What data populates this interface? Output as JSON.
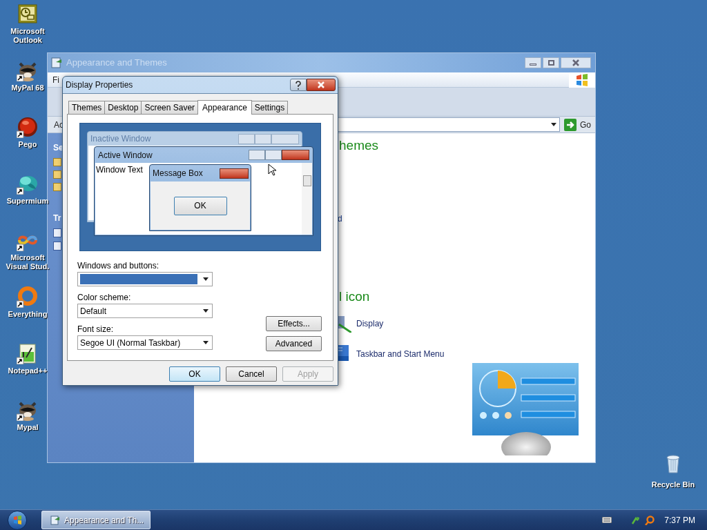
{
  "desktop_icons": [
    {
      "label": "Microsoft Outlook",
      "kind": "outlook",
      "shortcut": false
    },
    {
      "label": "MyPal 68",
      "kind": "raccoon",
      "shortcut": true
    },
    {
      "label": "Pego",
      "kind": "ball",
      "shortcut": true
    },
    {
      "label": "Supermium",
      "kind": "blob",
      "shortcut": true
    },
    {
      "label": "Microsoft Visual Stud.",
      "kind": "infinity",
      "shortcut": true
    },
    {
      "label": "Everything",
      "kind": "ring",
      "shortcut": true
    },
    {
      "label": "Notepad++",
      "kind": "notepad",
      "shortcut": true
    },
    {
      "label": "Mypal",
      "kind": "raccoon",
      "shortcut": true
    }
  ],
  "recycle_bin": {
    "label": "Recycle Bin"
  },
  "background_window": {
    "title": "Appearance and Themes",
    "menu_fragment": "Fi",
    "address_label": "Ac",
    "go_button": "Go",
    "side_panel": {
      "sections": [
        "Se",
        "Tr"
      ]
    },
    "heading_1": "hemes",
    "fragment": "d",
    "heading_2": "l icon",
    "links": [
      {
        "label": "Display",
        "kind": "display"
      },
      {
        "label": "Taskbar and Start Menu",
        "kind": "taskbar"
      }
    ]
  },
  "dialog": {
    "title": "Display Properties",
    "tabs": [
      {
        "label": "Themes",
        "selected": false
      },
      {
        "label": "Desktop",
        "selected": false
      },
      {
        "label": "Screen Saver",
        "selected": false
      },
      {
        "label": "Appearance",
        "selected": true
      },
      {
        "label": "Settings",
        "selected": false
      }
    ],
    "preview": {
      "inactive_title": "Inactive Window",
      "active_title": "Active Window",
      "window_text": "Window Text",
      "message_title": "Message Box",
      "message_button": "OK"
    },
    "fields": [
      {
        "label": "Windows and buttons:",
        "kind": "swatch"
      },
      {
        "label": "Color scheme:",
        "kind": "text",
        "value": "Default"
      },
      {
        "label": "Font size:",
        "kind": "text",
        "value": "Segoe UI (Normal Taskbar)"
      }
    ],
    "side_buttons": [
      "Effects...",
      "Advanced"
    ],
    "buttons": [
      {
        "label": "OK",
        "disabled": false,
        "default": true
      },
      {
        "label": "Cancel",
        "disabled": false,
        "default": false
      },
      {
        "label": "Apply",
        "disabled": true,
        "default": false
      }
    ]
  },
  "taskbar": {
    "tasks": [
      {
        "label": "Appearance and Th...",
        "selected": true
      }
    ],
    "clock": "7:37 PM"
  }
}
